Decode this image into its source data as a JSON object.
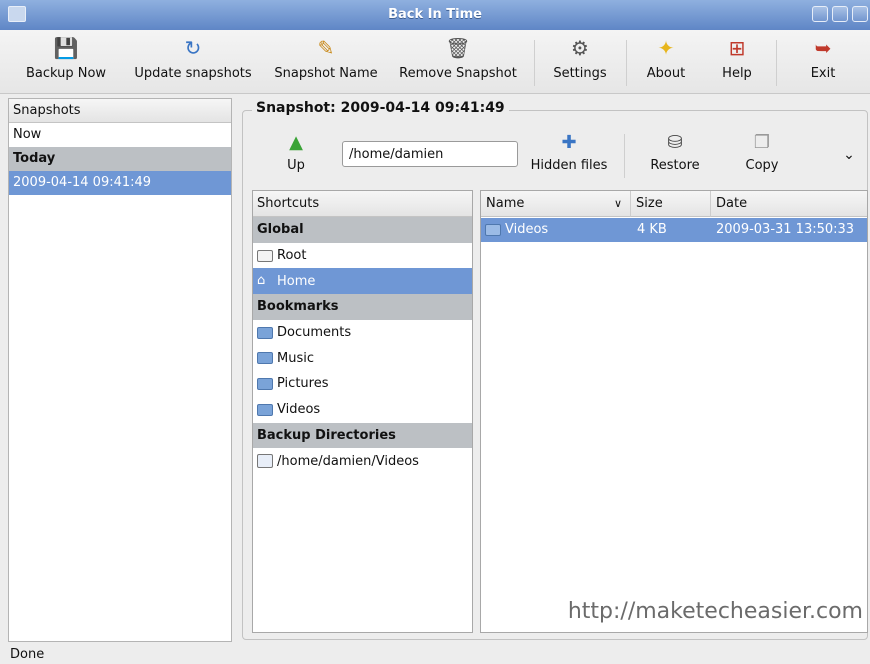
{
  "window": {
    "title": "Back In Time"
  },
  "toolbar": {
    "backup_now": "Backup Now",
    "update_snapshots": "Update snapshots",
    "snapshot_name": "Snapshot Name",
    "remove_snapshot": "Remove Snapshot",
    "settings": "Settings",
    "about": "About",
    "help": "Help",
    "exit": "Exit"
  },
  "snapshots": {
    "header": "Snapshots",
    "items": [
      {
        "label": "Now",
        "type": "item"
      },
      {
        "label": "Today",
        "type": "group"
      },
      {
        "label": "2009-04-14 09:41:49",
        "type": "selected"
      }
    ]
  },
  "snapshot_panel": {
    "title": "Snapshot: 2009-04-14 09:41:49",
    "up_label": "Up",
    "path_value": "/home/damien",
    "hidden_files_label": "Hidden files",
    "restore_label": "Restore",
    "copy_label": "Copy"
  },
  "shortcuts": {
    "header": "Shortcuts",
    "global": "Global",
    "root": "Root",
    "home": "Home",
    "bookmarks": "Bookmarks",
    "documents": "Documents",
    "music": "Music",
    "pictures": "Pictures",
    "videos": "Videos",
    "backup_directories": "Backup Directories",
    "backup_dir_1": "/home/damien/Videos"
  },
  "files": {
    "columns": {
      "name": "Name",
      "size": "Size",
      "date": "Date"
    },
    "rows": [
      {
        "name": "Videos",
        "size": "4 KB",
        "date": "2009-03-31 13:50:33"
      }
    ]
  },
  "watermark": "http://maketecheasier.com",
  "status": "Done"
}
